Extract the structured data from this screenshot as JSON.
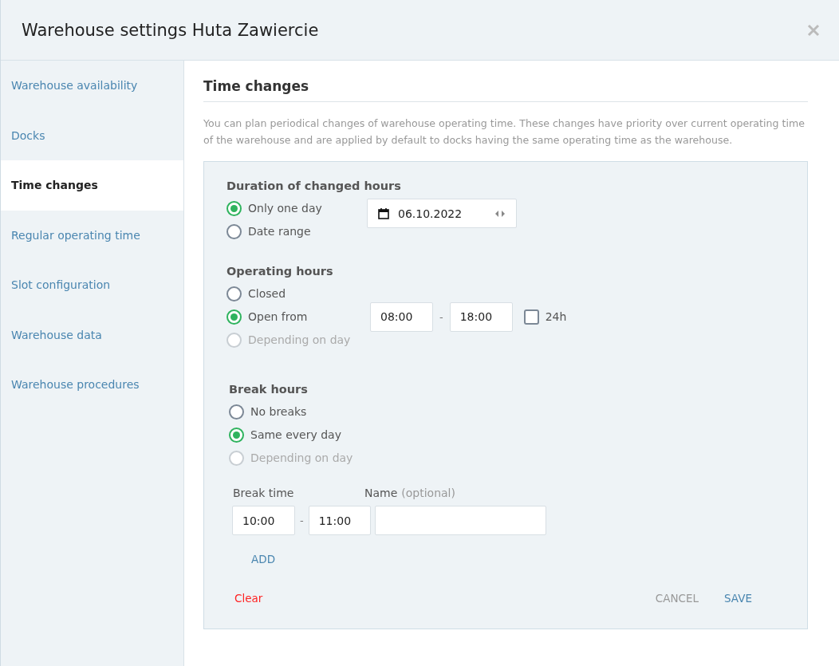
{
  "window": {
    "title": "Warehouse settings Huta Zawiercie"
  },
  "sidebar": {
    "items": [
      {
        "label": "Warehouse availability",
        "selected": false
      },
      {
        "label": "Docks",
        "selected": false
      },
      {
        "label": "Time changes",
        "selected": true
      },
      {
        "label": "Regular operating time",
        "selected": false
      },
      {
        "label": "Slot configuration",
        "selected": false
      },
      {
        "label": "Warehouse data",
        "selected": false
      },
      {
        "label": "Warehouse procedures",
        "selected": false
      }
    ]
  },
  "section": {
    "title": "Time changes",
    "description": "You can plan periodical changes of warehouse operating time. These changes have priority over current operating time of the warehouse and are applied by default to docks having the same operating time as the warehouse."
  },
  "duration": {
    "title": "Duration of changed hours",
    "options": [
      {
        "label": "Only one day",
        "selected": true,
        "disabled": false
      },
      {
        "label": "Date range",
        "selected": false,
        "disabled": false
      }
    ],
    "date": "06.10.2022"
  },
  "operating_hours": {
    "title": "Operating hours",
    "options": [
      {
        "label": "Closed",
        "selected": false,
        "disabled": false
      },
      {
        "label": "Open from",
        "selected": true,
        "disabled": false
      },
      {
        "label": "Depending on day",
        "selected": false,
        "disabled": true
      }
    ],
    "from": "08:00",
    "separator": "-",
    "to": "18:00",
    "all_day": {
      "label": "24h",
      "checked": false
    }
  },
  "break_hours": {
    "title": "Break hours",
    "options": [
      {
        "label": "No breaks",
        "selected": false,
        "disabled": false
      },
      {
        "label": "Same every day",
        "selected": true,
        "disabled": false
      },
      {
        "label": "Depending on day",
        "selected": false,
        "disabled": true
      }
    ],
    "break_time_label": "Break time",
    "name_label": "Name",
    "name_hint": "(optional)",
    "from": "10:00",
    "separator": "-",
    "to": "11:00",
    "add": "ADD"
  },
  "actions": {
    "clear": "Clear",
    "buttons": [
      {
        "label": "CANCEL",
        "disabled": true
      },
      {
        "label": "SAVE",
        "disabled": false
      }
    ]
  }
}
